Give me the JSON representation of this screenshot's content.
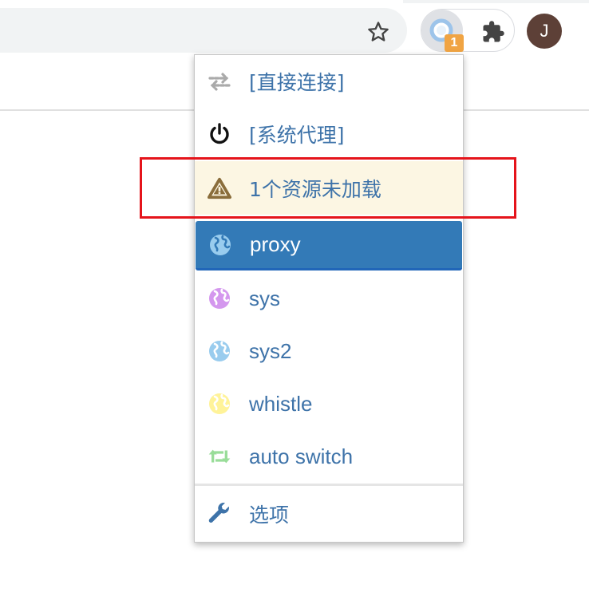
{
  "browser": {
    "toolbar": {
      "bookmark_icon": "star-outline-icon",
      "extension_icon": "proxy-globe-icon",
      "extension_badge": "1",
      "extensions_menu_icon": "puzzle-icon",
      "profile_initial": "J"
    }
  },
  "popup": {
    "items": [
      {
        "label": "[直接连接]",
        "icon": "direct-arrows-icon"
      },
      {
        "label": "[系统代理]",
        "icon": "power-icon"
      },
      {
        "label": "1个资源未加载",
        "icon": "warning-triangle-icon"
      },
      {
        "label": "proxy",
        "icon": "globe-icon",
        "selected": true
      },
      {
        "label": "sys",
        "icon": "globe-icon"
      },
      {
        "label": "sys2",
        "icon": "globe-icon"
      },
      {
        "label": "whistle",
        "icon": "globe-icon"
      },
      {
        "label": "auto switch",
        "icon": "retweet-icon"
      },
      {
        "label": "选项",
        "icon": "wrench-icon"
      }
    ]
  },
  "colors": {
    "link_text": "#3e73a9",
    "selected_bg": "#337ab7",
    "warning_bg": "#fcf6e3",
    "warning_icon": "#8a6d3b",
    "badge": "#f0a443",
    "highlight": "#e5141b",
    "globe_proxy": "#99ccee",
    "globe_sys": "#d497ee",
    "globe_sys2": "#99ccee",
    "globe_whistle": "#fff399",
    "autoswitch": "#99dd99",
    "avatar": "#5d4037"
  }
}
